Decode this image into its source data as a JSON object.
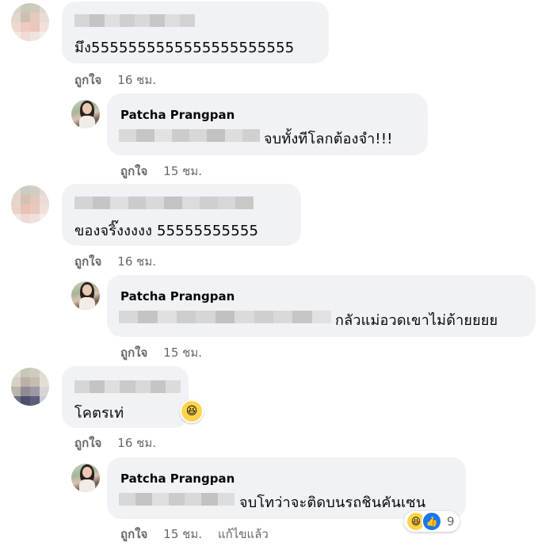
{
  "comments": [
    {
      "text": "มึง5555555555555555555555",
      "like_label": "ถูกใจ",
      "time": "16 ชม.",
      "reply": {
        "author": "Patcha Prangpan",
        "text": "จบทั้งทีโลกต้องจำ!!!",
        "like_label": "ถูกใจ",
        "time": "15 ชม."
      }
    },
    {
      "text": "ของจริ๊งงงงง 55555555555",
      "like_label": "ถูกใจ",
      "time": "16 ชม.",
      "reply": {
        "author": "Patcha Prangpan",
        "text": "กลัวแม่อวดเขาไม่ด้ายยยย",
        "like_label": "ถูกใจ",
        "time": "15 ชม."
      }
    },
    {
      "text": "โคตรเท่",
      "like_label": "ถูกใจ",
      "time": "16 ชม.",
      "reaction_icon": "laugh-reaction-icon",
      "reply": {
        "author": "Patcha Prangpan",
        "text": "จบโทว่าจะติดบนรถชินคันเซน",
        "like_label": "ถูกใจ",
        "time": "15 ชม.",
        "edited_label": "แก้ไขแล้ว",
        "reaction_icons": [
          "laugh-reaction-icon",
          "like-reaction-icon"
        ],
        "reaction_count": "9"
      }
    }
  ],
  "colors": {
    "bubble": "#f0f2f5",
    "meta_text": "#65676b",
    "like_blue": "#1877f2",
    "laugh_yellow": "#ffd34d"
  }
}
